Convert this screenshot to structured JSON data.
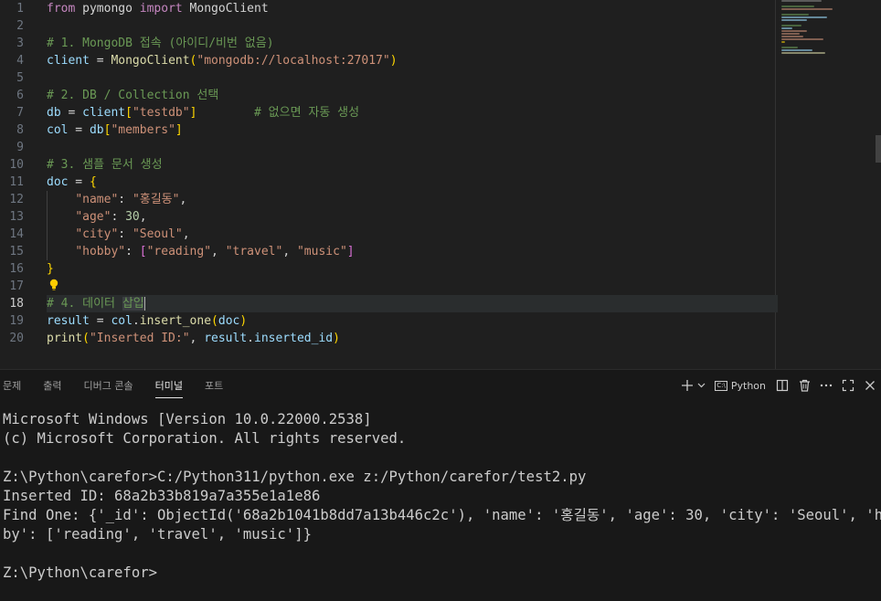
{
  "editor": {
    "line_numbers": [
      "1",
      "2",
      "3",
      "4",
      "5",
      "6",
      "7",
      "8",
      "9",
      "10",
      "11",
      "12",
      "13",
      "14",
      "15",
      "16",
      "17",
      "18",
      "19",
      "20"
    ],
    "active_line": "18",
    "code": {
      "l1": [
        "from",
        " pymongo ",
        "import",
        " MongoClient"
      ],
      "l3": "# 1. MongoDB 접속 (아이디/비번 없음)",
      "l4": [
        "client",
        " = ",
        "MongoClient",
        "(",
        "\"mongodb://localhost:27017\"",
        ")"
      ],
      "l6": "# 2. DB / Collection 선택",
      "l7": [
        "db",
        " = ",
        "client",
        "[",
        "\"testdb\"",
        "]",
        "        # 없으면 자동 생성"
      ],
      "l8": [
        "col",
        " = ",
        "db",
        "[",
        "\"members\"",
        "]"
      ],
      "l10": "# 3. 샘플 문서 생성",
      "l11": [
        "doc",
        " = ",
        "{"
      ],
      "l12": [
        "    ",
        "\"name\"",
        ": ",
        "\"홍길동\"",
        ","
      ],
      "l13": [
        "    ",
        "\"age\"",
        ": ",
        "30",
        ","
      ],
      "l14": [
        "    ",
        "\"city\"",
        ": ",
        "\"Seoul\"",
        ","
      ],
      "l15": [
        "    ",
        "\"hobby\"",
        ": ",
        "[",
        "\"reading\"",
        ", ",
        "\"travel\"",
        ", ",
        "\"music\"",
        "]"
      ],
      "l16": "}",
      "l18a": "# 4. 데이터 ",
      "l18b": "삽입",
      "l19": [
        "result",
        " = ",
        "col",
        ".",
        "insert_one",
        "(",
        "doc",
        ")"
      ],
      "l20": [
        "print",
        "(",
        "\"Inserted ID:\"",
        ", ",
        "result",
        ".",
        "inserted_id",
        ")"
      ]
    }
  },
  "panel": {
    "tabs": [
      {
        "label": "문제"
      },
      {
        "label": "출력"
      },
      {
        "label": "디버그 콘솔"
      },
      {
        "label": "터미널"
      },
      {
        "label": "포트"
      }
    ],
    "active_tab": "터미널",
    "terminal_profile": "Python",
    "icons": [
      "plus-icon",
      "chevron-down-icon",
      "terminal-icon",
      "split-icon",
      "trash-icon",
      "more-icon",
      "maximize-icon",
      "close-icon"
    ]
  },
  "terminal": {
    "lines": [
      "Microsoft Windows [Version 10.0.22000.2538]",
      "(c) Microsoft Corporation. All rights reserved.",
      "",
      "Z:\\Python\\carefor>C:/Python311/python.exe z:/Python/carefor/test2.py",
      "Inserted ID: 68a2b33b819a7a355e1a1e86",
      "Find One: {'_id': ObjectId('68a2b1041b8dd7a13b446c2c'), 'name': '홍길동', 'age': 30, 'city': 'Seoul', 'hob",
      "by': ['reading', 'travel', 'music']}",
      "",
      "Z:\\Python\\carefor>"
    ]
  },
  "colors": {
    "keyword": "#c586c0",
    "function": "#dcdcaa",
    "string": "#ce9178",
    "comment": "#6a9955",
    "number": "#b5cea8",
    "variable": "#9cdcfe",
    "bracket_gold": "#ffd700",
    "bracket_violet": "#da70d6",
    "editor_bg": "#1f1f1f",
    "panel_bg": "#181818"
  }
}
